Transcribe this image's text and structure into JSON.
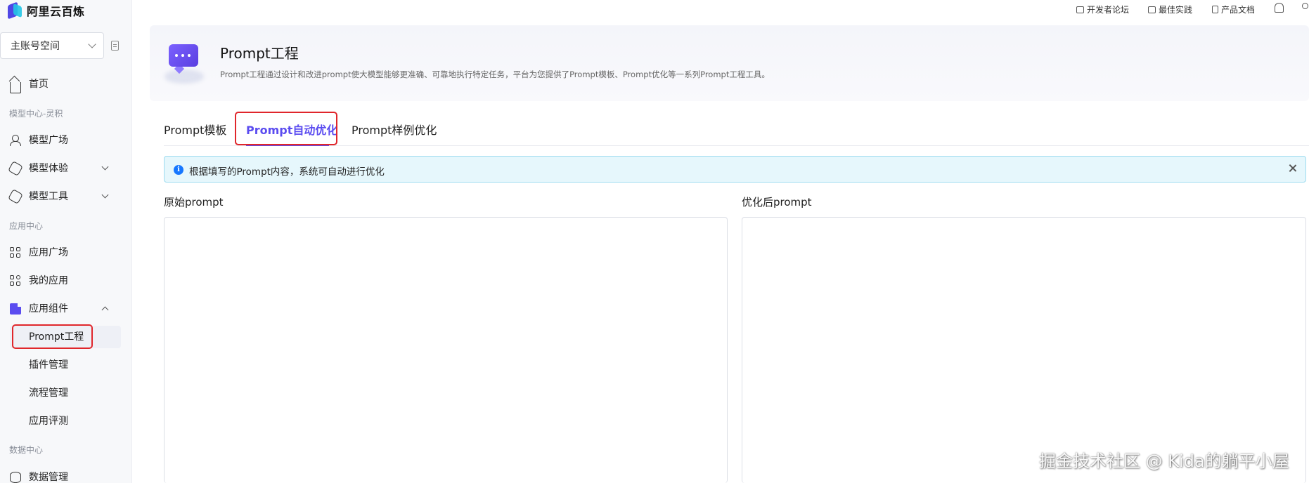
{
  "brand": {
    "name": "阿里云百炼"
  },
  "workspace": {
    "label": "主账号空间"
  },
  "topbar": {
    "links": [
      "开发者论坛",
      "最佳实践",
      "产品文档"
    ]
  },
  "sidebar": {
    "home": "首页",
    "section_model": "模型中心-灵积",
    "model_square": "模型广场",
    "model_experience": "模型体验",
    "model_tools": "模型工具",
    "section_app": "应用中心",
    "app_square": "应用广场",
    "my_apps": "我的应用",
    "app_components": "应用组件",
    "prompt_engineering": "Prompt工程",
    "plugin_mgmt": "插件管理",
    "flow_mgmt": "流程管理",
    "app_eval": "应用评测",
    "section_data": "数据中心",
    "data_mgmt": "数据管理"
  },
  "header": {
    "title": "Prompt工程",
    "description": "Prompt工程通过设计和改进prompt使大模型能够更准确、可靠地执行特定任务，平台为您提供了Prompt模板、Prompt优化等一系列Prompt工程工具。"
  },
  "tabs": [
    "Prompt模板",
    "Prompt自动优化",
    "Prompt样例优化"
  ],
  "active_tab": "Prompt自动优化",
  "alert": {
    "message": "根据填写的Prompt内容，系统可自动进行优化"
  },
  "panels": {
    "original_label": "原始prompt",
    "optimized_label": "优化后prompt"
  },
  "watermark": "掘金技术社区 @ Kida的躺平小屋",
  "colors": {
    "accent": "#5b4cf0",
    "highlight": "#e0262b",
    "alert_bg": "#e6f7fc"
  }
}
